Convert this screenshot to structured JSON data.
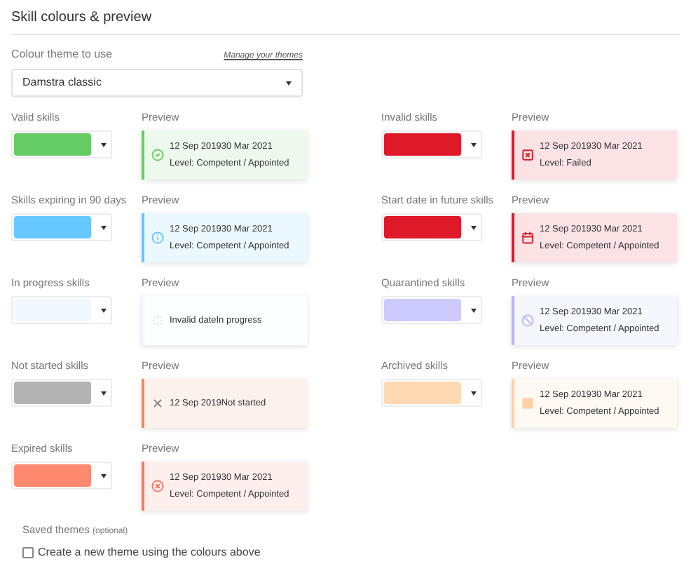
{
  "section_title": "Skill colours & preview",
  "theme": {
    "label": "Colour theme to use",
    "manage_link": "Manage your themes",
    "value": "Damstra classic"
  },
  "skills": [
    {
      "kind": "valid",
      "label": "Valid skills",
      "color": "#66cc66",
      "preview": {
        "label": "Preview",
        "color": "#66cc66",
        "lines": [
          "12 Sep 201930 Mar 2021",
          "Level: Competent / Appointed"
        ]
      }
    },
    {
      "kind": "invalid",
      "label": "Invalid skills",
      "color": "#de1a2a",
      "preview": {
        "label": "Preview",
        "color": "#de1a2a",
        "lines": [
          "12 Sep 201930 Mar 2021",
          "Level: Failed"
        ]
      }
    },
    {
      "kind": "expiring",
      "label": "Skills expiring in 90 days",
      "color": "#66c8ff",
      "preview": {
        "label": "Preview",
        "color": "#66c8ff",
        "lines": [
          "12 Sep 201930 Mar 2021",
          "Level: Competent / Appointed"
        ]
      }
    },
    {
      "kind": "future",
      "label": "Start date in future skills",
      "color": "#de1a2a",
      "preview": {
        "label": "Preview",
        "color": "#de1a2a",
        "lines": [
          "12 Sep 201930 Mar 2021",
          "Level: Competent / Appointed"
        ]
      }
    },
    {
      "kind": "in_progress",
      "label": "In progress skills",
      "color": "#f2f8ff",
      "preview": {
        "label": "Preview",
        "color": "#f2f8ff",
        "lines": [
          "Invalid dateIn progress"
        ]
      }
    },
    {
      "kind": "quarantined",
      "label": "Quarantined skills",
      "color": "#cccaff",
      "preview": {
        "label": "Preview",
        "color": "#b8b5ff",
        "lines": [
          "12 Sep 201930 Mar 2021",
          "Level: Competent / Appointed"
        ]
      }
    },
    {
      "kind": "not_started",
      "label": "Not started skills",
      "color": "#b3b3b3",
      "preview": {
        "label": "Preview",
        "color": "#f0895f",
        "lines": [
          "12 Sep 2019Not started"
        ]
      }
    },
    {
      "kind": "archived",
      "label": "Archived skills",
      "color": "#ffd9b3",
      "preview": {
        "label": "Preview",
        "color": "#ffd0a6",
        "lines": [
          "12 Sep 201930 Mar 2021",
          "Level: Competent / Appointed"
        ]
      }
    },
    {
      "kind": "expired",
      "label": "Expired skills",
      "color": "#ff8a70",
      "preview": {
        "label": "Preview",
        "color": "#f47a66",
        "lines": [
          "12 Sep 201930 Mar 2021",
          "Level: Competent / Appointed"
        ]
      }
    }
  ],
  "saved_themes": {
    "label": "Saved themes",
    "hint": "(optional)",
    "checkbox_label": "Create a new theme using the colours above",
    "checked": false
  }
}
